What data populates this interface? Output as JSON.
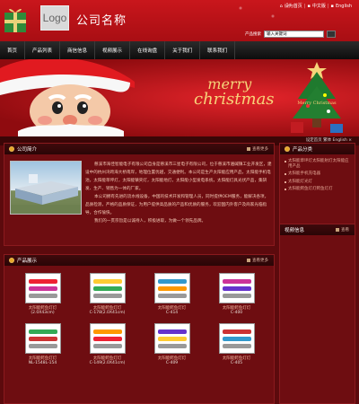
{
  "header": {
    "logo_text": "Logo",
    "company_name": "公司名称",
    "top_links": [
      "设为首页",
      "|",
      "中文版",
      "|",
      "English"
    ],
    "search_label": "产品搜索",
    "search_value": "输入关键词"
  },
  "nav": {
    "items": [
      "首页",
      "产品列表",
      "商信信息",
      "视频展示",
      "在线询盘",
      "关于我们",
      "联系我们"
    ]
  },
  "banner": {
    "line1": "merry",
    "line2": "christmas",
    "tree_text": "Merry Christmas"
  },
  "subbar": {
    "links": "设定首页   繁体   English   ×"
  },
  "intro": {
    "title": "公司简介",
    "more": "查看更多",
    "paragraphs": [
      "慈溪市海佳智能电子有限公司自身是慈溪市三星电子有限公司，位于慈溪市遍碱镇工业开发区，建设中的杭州湾跨海大桥南岸，地理位置优越，交通便利。本公司是生产太阳能应用产品，太阳能手机电池，太阳能草坪灯，太阳能镇夹灯，太阳能地灯，太阳能小型发电系统，太阳能灯具光伏产品，集研发、生产、销售为一体的厂家。",
      "本公司拥有先进的流水线设备，中国的技术开发和管理人员，同时提供OEM服务，能解决各项，品质检测，严格的品质保证，为用户提供高品质的产品和优质的服务，欢迎国内外客户及商家光临指导，合作愉快。",
      "我们的一贯宗旨是以诚待人，积极进取，为做一个领先品牌。"
    ]
  },
  "products": {
    "title": "产品展示",
    "more": "查看更多",
    "items": [
      {
        "name": "太阳能鳄鱼灯灯",
        "code": "(2.0X43cm)"
      },
      {
        "name": "太阳能鳄鱼灯灯",
        "code": "C-178(2.0X41cm)"
      },
      {
        "name": "太阳能鳄鱼灯灯",
        "code": "C-414"
      },
      {
        "name": "太阳能鳄鱼灯灯",
        "code": "C-400"
      },
      {
        "name": "太阳能鳄鱼灯灯",
        "code": "NL-1548L-154"
      },
      {
        "name": "太阳能鳄鱼灯灯",
        "code": "C-149(2.0X41cm)"
      },
      {
        "name": "太阳能鳄鱼灯灯",
        "code": "C-409"
      },
      {
        "name": "太阳能鳄鱼灯灯",
        "code": "C-405"
      }
    ]
  },
  "categories": {
    "title": "产品分类",
    "items": [
      "太阳能草坪灯太阳能射灯太阳能应用产品",
      "太阳能手机充电器",
      "太阳能灯光灯",
      "太阳能鳄鱼灯灯鳄鱼灯灯"
    ]
  },
  "video": {
    "title": "视频信息",
    "more": "查看"
  },
  "colors": {
    "page_bg": "#5c0a0d",
    "header_red": "#c9161c",
    "nav_black": "#111111",
    "accent_gold": "#f6d47a"
  }
}
